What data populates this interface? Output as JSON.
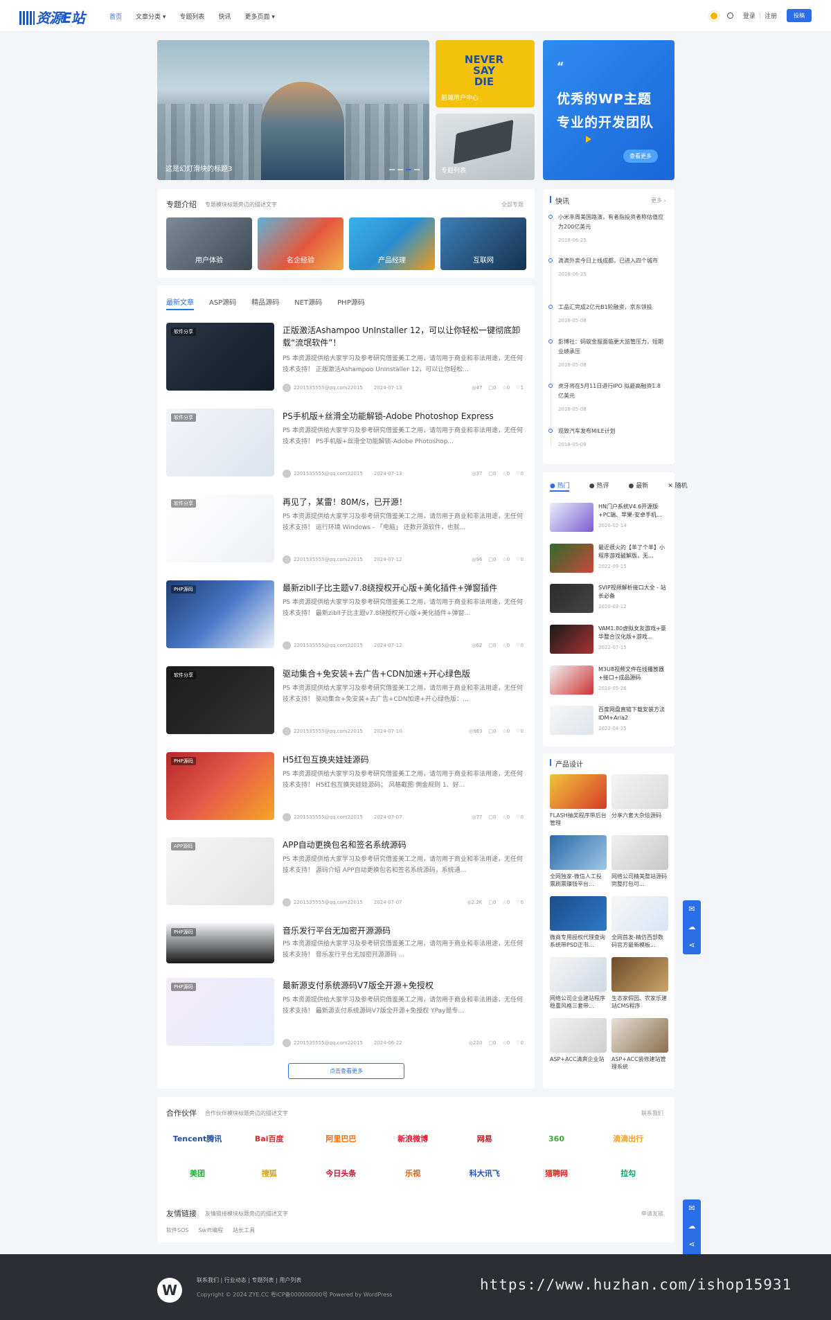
{
  "header": {
    "logo_text": "资源E站",
    "nav": [
      "首页",
      "文章分类",
      "专题列表",
      "快讯",
      "更多页面"
    ],
    "login": "登录",
    "sep": "|",
    "register": "注册",
    "submit": "投稿"
  },
  "banner": {
    "main_caption": "这是幻灯滑块的标题3",
    "tile1_text": "NEVER SAY DIE",
    "tile1_caption": "前端用户中心",
    "tile2_caption": "专题列表",
    "promo_quote": "“",
    "promo_line1": "优秀的WP主题",
    "promo_line2": "专业的开发团队",
    "promo_more": "查看更多"
  },
  "topics": {
    "title": "专题介绍",
    "desc": "专题模块标题旁边的描述文字",
    "more": "全部专题",
    "items": [
      "用户体验",
      "名企经验",
      "产品经理",
      "互联网"
    ]
  },
  "tabs": [
    "最新文章",
    "ASP源码",
    "精品源码",
    "NET源码",
    "PHP源码"
  ],
  "posts": [
    {
      "badge": "软件分享",
      "title": "正版激活Ashampoo UnInstaller 12，可以让你轻松一键彻底卸载“流氓软件”！",
      "desc": "PS 本资源提供给大家学习及参考研究借鉴美工之用，请勿用于商业和非法用途，无任何技术支持！ 正版激活Ashampoo UnInstaller 12，可以让你轻松...",
      "author": "2201535555@qq.com22015",
      "date": "2024-07-13",
      "views": "47",
      "comments": "0",
      "stars": "0",
      "likes": "1"
    },
    {
      "badge": "软件分享",
      "title": "PS手机版+丝滑全功能解锁-Adobe Photoshop Express",
      "desc": "PS 本资源提供给大家学习及参考研究借鉴美工之用，请勿用于商业和非法用途，无任何技术支持！ PS手机版+丝滑全功能解锁-Adobe Photoshop...",
      "author": "2201535555@qq.com22015",
      "date": "2024-07-13",
      "views": "37",
      "comments": "0",
      "stars": "0",
      "likes": "0"
    },
    {
      "badge": "软件分享",
      "title": "再见了，某雷！80M/s，已开源！",
      "desc": "PS 本资源提供给大家学习及参考研究借鉴美工之用，请勿用于商业和非法用途，无任何技术支持！ 运行环境 Windows - 「电脑」 还数开源软件，也就...",
      "author": "2201535555@qq.com22015",
      "date": "2024-07-12",
      "views": "96",
      "comments": "0",
      "stars": "0",
      "likes": "0"
    },
    {
      "badge": "PHP源码",
      "title": "最新zibll子比主题v7.8绕授权开心版+美化插件+弹窗插件",
      "desc": "PS 本资源提供给大家学习及参考研究借鉴美工之用，请勿用于商业和非法用途，无任何技术支持！ 最新zibll子比主题v7.8绕授权开心版+美化插件+弹窗...",
      "author": "2201535555@qq.com22015",
      "date": "2024-07-12",
      "views": "62",
      "comments": "0",
      "stars": "0",
      "likes": "0"
    },
    {
      "badge": "软件分享",
      "title": "驱动集合+免安装+去广告+CDN加速+开心绿色版",
      "desc": "PS 本资源提供给大家学习及参考研究借鉴美工之用，请勿用于商业和非法用途，无任何技术支持！ 驱动集合+免安装+去广告+CDN加速+开心绿色版：...",
      "author": "2201535555@qq.com22015",
      "date": "2024-07-10",
      "views": "983",
      "comments": "0",
      "stars": "0",
      "likes": "0"
    },
    {
      "badge": "PHP源码",
      "title": "H5红包互换夹娃娃源码",
      "desc": "PS 本资源提供给大家学习及参考研究借鉴美工之用，请勿用于商业和非法用途，无任何技术支持！ H5红包互换夹娃娃源码； 风格截图 佣金规则 1、好...",
      "author": "2201535555@qq.com22015",
      "date": "2024-07-07",
      "views": "77",
      "comments": "0",
      "stars": "0",
      "likes": "0"
    },
    {
      "badge": "APP源码",
      "title": "APP自动更换包名和签名系统源码",
      "desc": "PS 本资源提供给大家学习及参考研究借鉴美工之用，请勿用于商业和非法用途，无任何技术支持！ 源码介绍 APP自动更换包名和签名系统源码，系统通...",
      "author": "2201535555@qq.com22015",
      "date": "2024-07-07",
      "views": "2.2K",
      "comments": "0",
      "stars": "0",
      "likes": "0"
    },
    {
      "badge": "PHP源码",
      "title": "音乐发行平台无加密开源源码",
      "desc": "PS 本资源提供给大家学习及参考研究借鉴美工之用，请勿用于商业和非法用途，无任何技术支持！ 音乐发行平台无加密开源源码 ...",
      "author": "",
      "date": "",
      "views": "",
      "comments": "",
      "stars": "",
      "likes": ""
    },
    {
      "badge": "PHP源码",
      "title": "最新源支付系统源码V7版全开源+免授权",
      "desc": "PS 本资源提供给大家学习及参考研究借鉴美工之用，请勿用于商业和非法用途，无任何技术支持！ 最新源支付系统源码V7版全开源+免授权 YPay是专...",
      "author": "2201535555@qq.com22015",
      "date": "2024-06-22",
      "views": "220",
      "comments": "0",
      "stars": "0",
      "likes": "0"
    }
  ],
  "load_more": "点击查看更多",
  "flash": {
    "title": "快讯",
    "more": "更多 ›",
    "items": [
      {
        "text": "小米丰周美国路演，有者指投资者称估值应为200亿美元",
        "date": "2018-06-25"
      },
      {
        "text": "滴滴外卖今日上线成都，已进入四个城市",
        "date": "2018-06-25"
      },
      {
        "text": "工品汇完成2亿元B1轮融资，京东领投",
        "date": "2018-05-08"
      },
      {
        "text": "彭博社：蚂蚁金服面临更大监管压力，短期业绩承压",
        "date": "2018-05-08"
      },
      {
        "text": "虎牙将在5月11日进行IPO 拟最高融资1.8亿美元",
        "date": "2018-05-08"
      },
      {
        "text": "观致汽车发布MILE计划",
        "date": "2018-05-08"
      }
    ]
  },
  "hot": {
    "tabs": [
      "热门",
      "热评",
      "最新",
      "随机"
    ],
    "items": [
      {
        "title": "HN门户系统V4.6开源版+PC端、苹果-安卓手机...",
        "date": "2020-02-14"
      },
      {
        "title": "最近很火的【羊了个羊】小程序游戏破解版，无...",
        "date": "2022-09-15"
      },
      {
        "title": "SVIP视频解析接口大全 - 站长必备",
        "date": "2020-03-12"
      },
      {
        "title": "VAM1.80虚拟女友游戏+豪华整合汉化版+游戏...",
        "date": "2022-07-15"
      },
      {
        "title": "M3U8视频文件在线播放器+接口+成品源码",
        "date": "2020-05-26"
      },
      {
        "title": "百度网盘直链下载安装方法IDM+Aria2",
        "date": "2022-04-25"
      }
    ]
  },
  "product": {
    "title": "产品设计",
    "items": [
      "FLASH抽奖程序带后台管理",
      "分享六套大杂烩源码",
      "全网独家-微信人工投票刷票赚钱平台...",
      "网络公司精美整站源码完整打包可...",
      "微商专用授权代理查询系统带PSD正书...",
      "全网首发-精仿西部数码官方最新模板...",
      "网络公司企业建站程序稳重风格三套带...",
      "生态家假园、农家乐建站CMS程序",
      "ASP+ACC清爽企业站",
      "ASP+ACC装修建站管理系统"
    ]
  },
  "partners": {
    "title": "合作伙伴",
    "desc": "合作伙伴模块标题旁边的描述文字",
    "more": "联系我们",
    "items": [
      "Tencent腾讯",
      "Bai百度",
      "阿里巴巴",
      "新浪微博",
      "网易",
      "360",
      "滴滴出行",
      "美团",
      "搜狐",
      "今日头条",
      "乐视",
      "科大讯飞",
      "猎聘网",
      "拉勾"
    ]
  },
  "links": {
    "title": "友情链接",
    "desc": "友情链接模块标题旁边的描述文字",
    "more": "申请友链",
    "items": [
      "软件SOS",
      "Swift编程",
      "站长工具"
    ]
  },
  "footer": {
    "links": "联系我们   |   行业动态   |   专题列表   |   用户列表",
    "copy": "Copyright © 2024 ZYE.CC 粤ICP备000000000号 Powered by WordPress",
    "watermark": "https://www.huzhan.com/ishop15931"
  },
  "colors": {
    "accent": "#2a6ee8",
    "footer_bg": "#2b2e33"
  }
}
